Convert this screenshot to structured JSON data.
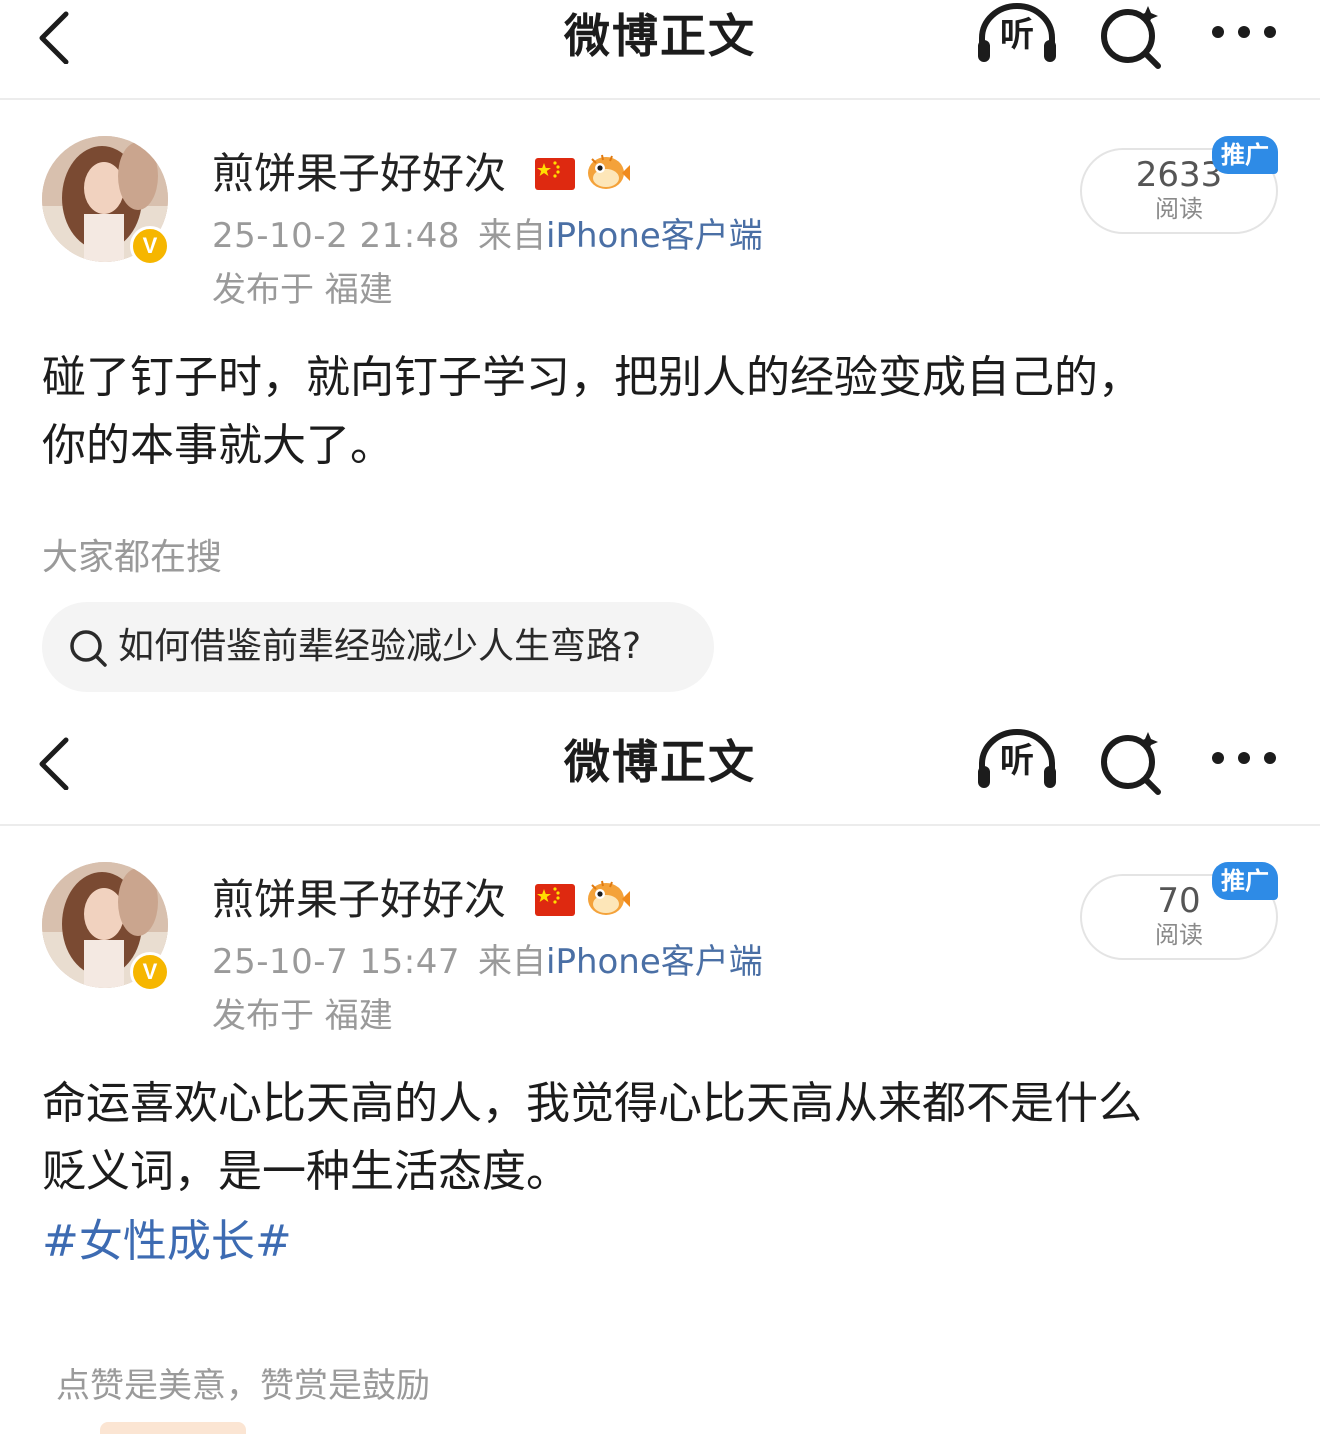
{
  "colors": {
    "link": "#4a6fa5",
    "hashtag": "#3d6bb2",
    "promo_badge": "#2e8be6",
    "verified": "#f6b600",
    "muted_text": "#9a9a9a"
  },
  "icons": {
    "back": "chevron-left-icon",
    "listen": "headphones-icon",
    "search": "search-sparkle-icon",
    "more": "more-dots-icon",
    "flag": "china-flag-icon",
    "fish": "pufferfish-icon",
    "verified": "verified-v-icon"
  },
  "screen1": {
    "nav": {
      "title": "微博正文",
      "listen_label": "听"
    },
    "post": {
      "username": "煎饼果子好好次",
      "verified_mark": "V",
      "time": "25-10-2 21:48",
      "from_label": "来自",
      "client": "iPhone客户端",
      "location": "发布于 福建",
      "reads_count": "2633",
      "reads_label": "阅读",
      "promo_badge": "推广",
      "text_line1": "碰了钉子时，就向钉子学习，把别人的经验变成自己的，",
      "text_line2": "你的本事就大了。"
    },
    "trending": {
      "label": "大家都在搜",
      "query": "如何借鉴前辈经验减少人生弯路?"
    }
  },
  "screen2": {
    "nav": {
      "title": "微博正文",
      "listen_label": "听"
    },
    "post": {
      "username": "煎饼果子好好次",
      "verified_mark": "V",
      "time": "25-10-7 15:47",
      "from_label": "来自",
      "client": "iPhone客户端",
      "location": "发布于 福建",
      "reads_count": "70",
      "reads_label": "阅读",
      "promo_badge": "推广",
      "text_line1": "命运喜欢心比天高的人，我觉得心比天高从来都不是什么",
      "text_line2": "贬义词，是一种生活态度。",
      "hashtag": "#女性成长#"
    },
    "reward": {
      "text": "点赞是美意，赞赏是鼓励"
    }
  }
}
